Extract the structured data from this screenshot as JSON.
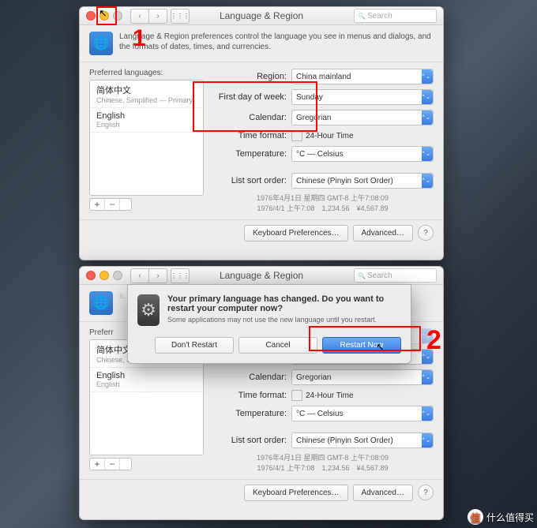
{
  "title": "Language & Region",
  "searchPlaceholder": "Search",
  "headerText": "Language & Region preferences control the language you see in menus and dialogs, and the formats of dates, times, and currencies.",
  "preferredLabel": "Preferred languages:",
  "langs": [
    {
      "name": "简体中文",
      "sub": "Chinese, Simplified — Primary"
    },
    {
      "name": "English",
      "sub": "English"
    }
  ],
  "rows": {
    "region": {
      "label": "Region:",
      "value": "China mainland"
    },
    "firstday": {
      "label": "First day of week:",
      "value": "Sunday"
    },
    "calendar": {
      "label": "Calendar:",
      "value": "Gregorian"
    },
    "timefmt": {
      "label": "Time format:",
      "value": "24-Hour Time"
    },
    "temp": {
      "label": "Temperature:",
      "value": "°C — Celsius"
    },
    "sort": {
      "label": "List sort order:",
      "value": "Chinese (Pinyin Sort Order)"
    }
  },
  "sample": {
    "line1": "1976年4月1日 星期四 GMT-8 上午7:08:09",
    "line2": "1976/4/1 上午7:08　1,234.56　¥4,567.89"
  },
  "footer": {
    "kb": "Keyboard Preferences…",
    "adv": "Advanced…"
  },
  "dialog": {
    "heading": "Your primary language has changed. Do you want to restart your computer now?",
    "sub": "Some applications may not use the new language until you restart.",
    "dontRestart": "Don't Restart",
    "cancel": "Cancel",
    "restart": "Restart Now"
  },
  "anno": {
    "one": "1",
    "two": "2"
  },
  "watermark": "什么值得买"
}
